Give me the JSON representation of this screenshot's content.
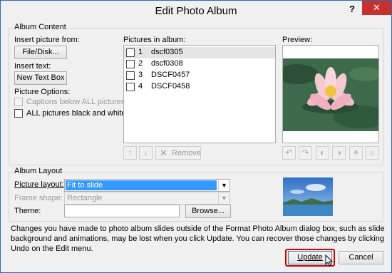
{
  "window": {
    "title": "Edit Photo Album",
    "help_label": "?",
    "close_label": "✕"
  },
  "album_content": {
    "group_label": "Album Content",
    "insert_picture_from": "Insert picture from:",
    "file_disk_button": "File/Disk...",
    "insert_text": "Insert text:",
    "new_text_box_button": "New Text Box",
    "picture_options": "Picture Options:",
    "captions_below_label": "Captions below ALL pictures",
    "all_black_white_label": "ALL pictures black and white",
    "pictures_in_album": "Pictures in album:",
    "pictures": [
      {
        "num": "1",
        "name": "dscf0305"
      },
      {
        "num": "2",
        "name": "dscf0308"
      },
      {
        "num": "3",
        "name": "DSCF0457"
      },
      {
        "num": "4",
        "name": "DSCF0458"
      }
    ],
    "remove_button": "Remove",
    "preview_label": "Preview:"
  },
  "album_layout": {
    "group_label": "Album Layout",
    "picture_layout_label": "Picture layout:",
    "picture_layout_value": "Fit to slide",
    "frame_shape_label": "Frame shape:",
    "frame_shape_value": "Rectangle",
    "theme_label": "Theme:",
    "theme_value": "",
    "browse_button": "Browse..."
  },
  "notice": "Changes you have made to photo album slides outside of the Format Photo Album dialog box, such as slide background and animations, may be lost when you click Update. You can recover those changes by clicking Undo on the Edit menu.",
  "footer": {
    "update_button": "Update",
    "cancel_button": "Cancel"
  },
  "colors": {
    "close_red": "#c7302c",
    "highlight_red": "#d40000",
    "selection_blue": "#3399ff"
  },
  "icons": [
    "move-up-icon",
    "move-down-icon",
    "remove-x-icon",
    "rotate-left-icon",
    "rotate-right-icon",
    "contrast-more-icon",
    "contrast-less-icon",
    "brightness-more-icon",
    "brightness-less-icon",
    "dropdown-arrow-icon",
    "mouse-cursor-icon"
  ]
}
